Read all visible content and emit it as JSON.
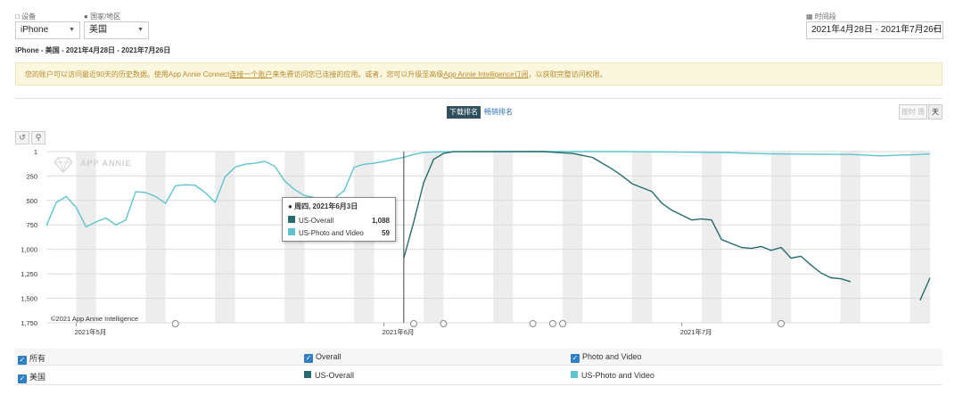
{
  "filters": {
    "device_label": "设备",
    "device_value": "iPhone",
    "country_label": "国家/地区",
    "country_value": "美国",
    "period_label": "时间段",
    "period_value": "2021年4月28日 - 2021年7月26日"
  },
  "subtitle": "iPhone - 美国 - 2021年4月28日 - 2021年7月26日",
  "notice": {
    "p1": "您的账户可以访问最近90天的历史数据。使用App Annie Connect",
    "link1": "连接一个账户",
    "p2": "来免费访问您已连接的应用。或者，您可以升级至高级",
    "link2": "App Annie Intelligence订阅",
    "p3": "，以获取完整访问权限。"
  },
  "rank_toggle": {
    "active": "下载排名",
    "other": "畅销排名"
  },
  "granularity": {
    "week": "周",
    "day": "天",
    "left": "按时"
  },
  "watermark": "APP ANNIE",
  "copyright": "©2021 App Annie Intelligence",
  "tooltip": {
    "title": "周四, 2021年6月3日",
    "rows": [
      {
        "name": "US-Overall",
        "value": "1,088"
      },
      {
        "name": "US-Photo and Video",
        "value": "59"
      }
    ]
  },
  "legend": {
    "all_label": "所有",
    "overall_header": "Overall",
    "photo_header": "Photo and Video",
    "country_label": "美国",
    "series1_label": "US-Overall",
    "series2_label": "US-Photo and Video"
  },
  "chart_data": {
    "type": "line",
    "x_ticks": [
      "2021年5月",
      "2021年6月",
      "2021年7月"
    ],
    "y_ticks": [
      "1",
      "250",
      "500",
      "750",
      "1,000",
      "1,250",
      "1,500",
      "1,750"
    ],
    "ylim": [
      1,
      1750
    ],
    "y_inverted": true,
    "x_start": "2021-04-28",
    "x_end": "2021-07-26",
    "grid": true,
    "colors": {
      "overall": "#256b6f",
      "photo": "#5ec4d0"
    },
    "series": [
      {
        "name": "US-Photo and Video",
        "color": "#5ec4d0",
        "points": [
          [
            "2021-04-28",
            760
          ],
          [
            "2021-04-29",
            520
          ],
          [
            "2021-04-30",
            460
          ],
          [
            "2021-05-01",
            570
          ],
          [
            "2021-05-02",
            770
          ],
          [
            "2021-05-03",
            720
          ],
          [
            "2021-05-04",
            680
          ],
          [
            "2021-05-05",
            750
          ],
          [
            "2021-05-06",
            700
          ],
          [
            "2021-05-07",
            410
          ],
          [
            "2021-05-08",
            420
          ],
          [
            "2021-05-09",
            460
          ],
          [
            "2021-05-10",
            530
          ],
          [
            "2021-05-11",
            350
          ],
          [
            "2021-05-12",
            340
          ],
          [
            "2021-05-13",
            345
          ],
          [
            "2021-05-14",
            420
          ],
          [
            "2021-05-15",
            520
          ],
          [
            "2021-05-16",
            260
          ],
          [
            "2021-05-17",
            160
          ],
          [
            "2021-05-18",
            130
          ],
          [
            "2021-05-19",
            120
          ],
          [
            "2021-05-20",
            100
          ],
          [
            "2021-05-21",
            150
          ],
          [
            "2021-05-22",
            300
          ],
          [
            "2021-05-23",
            390
          ],
          [
            "2021-05-24",
            450
          ],
          [
            "2021-05-25",
            470
          ],
          [
            "2021-05-26",
            500
          ],
          [
            "2021-05-27",
            480
          ],
          [
            "2021-05-28",
            400
          ],
          [
            "2021-05-29",
            160
          ],
          [
            "2021-05-30",
            130
          ],
          [
            "2021-05-31",
            120
          ],
          [
            "2021-06-01",
            100
          ],
          [
            "2021-06-02",
            80
          ],
          [
            "2021-06-03",
            59
          ],
          [
            "2021-06-04",
            30
          ],
          [
            "2021-06-05",
            10
          ],
          [
            "2021-06-06",
            5
          ],
          [
            "2021-06-08",
            2
          ],
          [
            "2021-06-15",
            1
          ],
          [
            "2021-06-25",
            1
          ],
          [
            "2021-07-05",
            10
          ],
          [
            "2021-07-10",
            25
          ],
          [
            "2021-07-18",
            30
          ],
          [
            "2021-07-21",
            45
          ],
          [
            "2021-07-25",
            30
          ],
          [
            "2021-07-26",
            25
          ]
        ]
      },
      {
        "name": "US-Overall",
        "color": "#256b6f",
        "points": [
          [
            "2021-06-03",
            1088
          ],
          [
            "2021-06-04",
            720
          ],
          [
            "2021-06-05",
            320
          ],
          [
            "2021-06-06",
            80
          ],
          [
            "2021-06-07",
            20
          ],
          [
            "2021-06-08",
            2
          ],
          [
            "2021-06-17",
            1
          ],
          [
            "2021-06-20",
            20
          ],
          [
            "2021-06-21",
            40
          ],
          [
            "2021-06-22",
            60
          ],
          [
            "2021-06-23",
            120
          ],
          [
            "2021-06-24",
            180
          ],
          [
            "2021-06-25",
            250
          ],
          [
            "2021-06-26",
            330
          ],
          [
            "2021-06-27",
            370
          ],
          [
            "2021-06-28",
            410
          ],
          [
            "2021-06-29",
            530
          ],
          [
            "2021-06-30",
            600
          ],
          [
            "2021-07-01",
            650
          ],
          [
            "2021-07-02",
            700
          ],
          [
            "2021-07-03",
            690
          ],
          [
            "2021-07-04",
            700
          ],
          [
            "2021-07-05",
            900
          ],
          [
            "2021-07-06",
            940
          ],
          [
            "2021-07-07",
            980
          ],
          [
            "2021-07-08",
            990
          ],
          [
            "2021-07-09",
            970
          ],
          [
            "2021-07-10",
            1010
          ],
          [
            "2021-07-11",
            980
          ],
          [
            "2021-07-12",
            1090
          ],
          [
            "2021-07-13",
            1070
          ],
          [
            "2021-07-14",
            1160
          ],
          [
            "2021-07-15",
            1240
          ],
          [
            "2021-07-16",
            1290
          ],
          [
            "2021-07-17",
            1300
          ],
          [
            "2021-07-18",
            1330
          ]
        ]
      },
      {
        "name": "US-Overall",
        "color": "#256b6f",
        "points": [
          [
            "2021-07-25",
            1520
          ],
          [
            "2021-07-26",
            1290
          ]
        ]
      }
    ]
  }
}
